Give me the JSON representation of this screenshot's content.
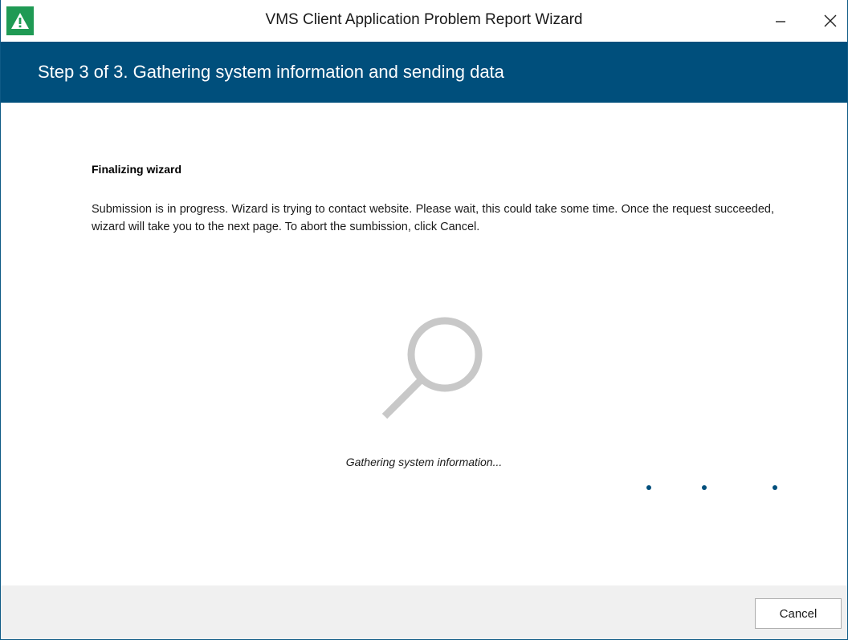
{
  "window": {
    "title": "VMS Client Application Problem Report Wizard",
    "app_icon": "warning-triangle-icon",
    "controls": [
      "minimize-icon",
      "close-icon"
    ]
  },
  "header": {
    "step_title": "Step 3 of 3. Gathering system information and sending data"
  },
  "content": {
    "heading": "Finalizing wizard",
    "description": "Submission is in progress. Wizard is trying to contact website. Please wait, this could take some time. Once the request succeeded, wizard will take you to the next page. To abort the sumbission, click Cancel.",
    "graphic": "magnifier-icon",
    "status": "Gathering system information...",
    "progress_indicator": "dots"
  },
  "footer": {
    "cancel_label": "Cancel"
  },
  "colors": {
    "accent": "#004f7c",
    "icon_green": "#1f9a54",
    "footer_bg": "#f0f0f0",
    "graphic_gray": "#c8c8c8"
  }
}
